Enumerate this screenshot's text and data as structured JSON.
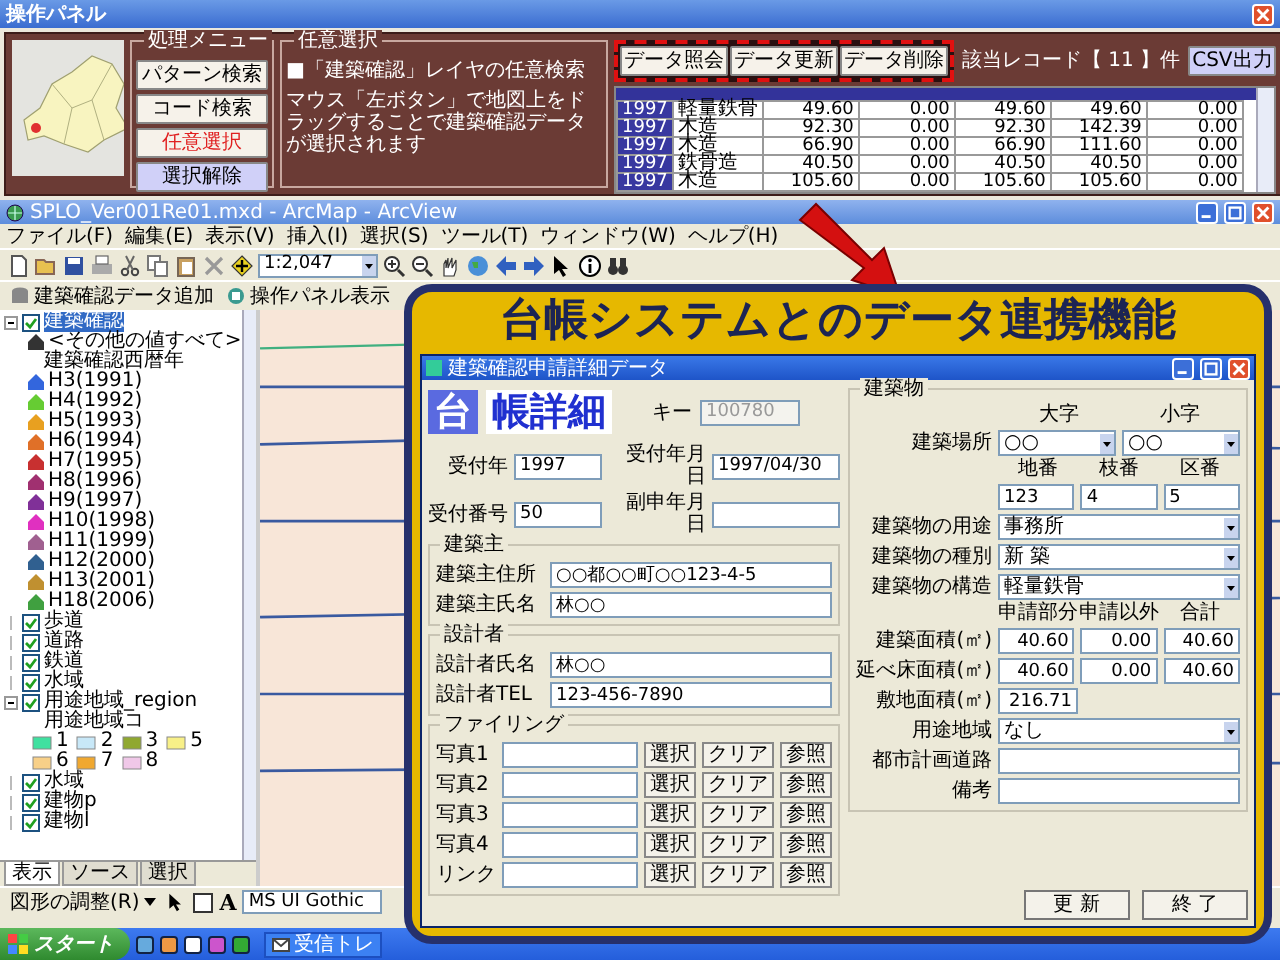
{
  "panel": {
    "title": "操作パネル",
    "menu_legend": "処理メニュー",
    "menu_buttons": [
      {
        "label": "パターン検索",
        "selected": false,
        "kind": "normal"
      },
      {
        "label": "コード検索",
        "selected": false,
        "kind": "normal"
      },
      {
        "label": "任意選択",
        "selected": true,
        "kind": "normal"
      },
      {
        "label": "選択解除",
        "selected": false,
        "kind": "reset"
      }
    ],
    "select_legend": "任意選択",
    "select_heading": "■「建築確認」レイヤの任意検索",
    "select_text": "マウス「左ボタン」で地図上をドラッグすることで建築確認データが選択されます",
    "data_buttons": [
      "データ照会",
      "データ更新",
      "データ削除"
    ],
    "record_count": "該当レコード【 11 】件",
    "csv_button": "CSV出力",
    "table": {
      "rows": [
        [
          "1997",
          "軽量鉄骨",
          "49.60",
          "0.00",
          "49.60",
          "49.60",
          "0.00"
        ],
        [
          "1997",
          "木造",
          "92.30",
          "0.00",
          "92.30",
          "142.39",
          "0.00"
        ],
        [
          "1997",
          "木造",
          "66.90",
          "0.00",
          "66.90",
          "111.60",
          "0.00"
        ],
        [
          "1997",
          "鉄骨造",
          "40.50",
          "0.00",
          "40.50",
          "40.50",
          "0.00"
        ],
        [
          "1997",
          "木造",
          "105.60",
          "0.00",
          "105.60",
          "105.60",
          "0.00"
        ]
      ]
    }
  },
  "arcmap": {
    "title": "SPLO_Ver001Re01.mxd - ArcMap - ArcView",
    "menu": [
      "ファイル(F)",
      "編集(E)",
      "表示(V)",
      "挿入(I)",
      "選択(S)",
      "ツール(T)",
      "ウィンドウ(W)",
      "ヘルプ(H)"
    ],
    "scale": "1:2,047",
    "tool_buttons": [
      "建築確認データ追加",
      "操作パネル表示"
    ],
    "toc": [
      {
        "label": "建築確認",
        "checked": true,
        "selected": true,
        "children": [
          {
            "kind": "symbol",
            "label": "<その他の値すべて>",
            "color": "#333333"
          },
          {
            "kind": "heading",
            "label": "建築確認西暦年"
          },
          {
            "kind": "symbol",
            "label": "H3(1991)",
            "color": "#3366dd"
          },
          {
            "kind": "symbol",
            "label": "H4(1992)",
            "color": "#66cc33"
          },
          {
            "kind": "symbol",
            "label": "H5(1993)",
            "color": "#e8a020"
          },
          {
            "kind": "symbol",
            "label": "H6(1994)",
            "color": "#e07028"
          },
          {
            "kind": "symbol",
            "label": "H7(1995)",
            "color": "#c83030"
          },
          {
            "kind": "symbol",
            "label": "H8(1996)",
            "color": "#a03070"
          },
          {
            "kind": "symbol",
            "label": "H9(1997)",
            "color": "#803098"
          },
          {
            "kind": "symbol",
            "label": "H10(1998)",
            "color": "#e030c0"
          },
          {
            "kind": "symbol",
            "label": "H11(1999)",
            "color": "#a06090"
          },
          {
            "kind": "symbol",
            "label": "H12(2000)",
            "color": "#306090"
          },
          {
            "kind": "symbol",
            "label": "H13(2001)",
            "color": "#c09030"
          },
          {
            "kind": "symbol",
            "label": "H18(2006)",
            "color": "#40a040"
          }
        ]
      },
      {
        "label": "歩道",
        "checked": true,
        "selected": false
      },
      {
        "label": "道路",
        "checked": true,
        "selected": false
      },
      {
        "label": "鉄道",
        "checked": true,
        "selected": false
      },
      {
        "label": "水域",
        "checked": true,
        "selected": false
      },
      {
        "label": "用途地域_region",
        "checked": true,
        "selected": false,
        "children": [
          {
            "kind": "heading",
            "label": "用途地域コ"
          },
          {
            "kind": "swatch",
            "label": "1",
            "color": "#40e0a0"
          },
          {
            "kind": "swatch",
            "label": "2",
            "color": "#c8e8f8"
          },
          {
            "kind": "swatch",
            "label": "3",
            "color": "#90a830"
          },
          {
            "kind": "swatch",
            "label": "5",
            "color": "#f8f088"
          },
          {
            "kind": "swatch",
            "label": "6",
            "color": "#f8d088"
          },
          {
            "kind": "swatch",
            "label": "7",
            "color": "#f0a830"
          },
          {
            "kind": "swatch",
            "label": "8",
            "color": "#f0c8e8"
          }
        ]
      },
      {
        "label": "水域",
        "checked": true,
        "selected": false
      },
      {
        "label": "建物p",
        "checked": true,
        "selected": false
      },
      {
        "label": "建物l",
        "checked": true,
        "selected": false
      }
    ],
    "toc_tabs": [
      {
        "label": "表示",
        "selected": true
      },
      {
        "label": "ソース",
        "selected": false
      },
      {
        "label": "選択",
        "selected": false
      }
    ],
    "draw_menu": "図形の調整(R)",
    "text_tool": "A",
    "font": "MS UI Gothic"
  },
  "taskbar": {
    "start": "スタート",
    "task": "受信トレ"
  },
  "callout": {
    "title": "台帳システムとのデータ連携機能",
    "form": {
      "title": "建築確認申請詳細データ",
      "logo_mark": "台",
      "logo_text": "帳詳細",
      "key_label": "キー",
      "key_value": "100780",
      "key_disabled": true,
      "fields": [
        {
          "label": "受付年",
          "value": "1997"
        },
        {
          "label": "受付年月日",
          "value": "1997/04/30"
        },
        {
          "label": "受付番号",
          "value": "50"
        },
        {
          "label": "副申年月日"
        }
      ],
      "groups": [
        {
          "legend": "建築主",
          "fields": [
            {
              "label": "建築主住所",
              "value": "○○都○○町○○123-4-5"
            },
            {
              "label": "建築主氏名",
              "value": "林○○"
            }
          ]
        },
        {
          "legend": "設計者",
          "fields": [
            {
              "label": "設計者氏名",
              "value": "林○○"
            },
            {
              "label": "設計者TEL",
              "value": "123-456-7890"
            }
          ]
        }
      ],
      "filing": {
        "legend": "ファイリング",
        "rows": [
          {
            "label": "写真1",
            "buttons": [
              "選択",
              "クリア",
              "参照"
            ]
          },
          {
            "label": "写真2",
            "buttons": [
              "選択",
              "クリア",
              "参照"
            ]
          },
          {
            "label": "写真3",
            "buttons": [
              "選択",
              "クリア",
              "参照"
            ]
          },
          {
            "label": "写真4",
            "buttons": [
              "選択",
              "クリア",
              "参照"
            ]
          },
          {
            "label": "リンク",
            "buttons": [
              "選択",
              "クリア",
              "参照"
            ]
          }
        ]
      },
      "building": {
        "legend": "建築物",
        "place_heads": [
          "大字",
          "小字"
        ],
        "place_label": "建築場所",
        "place": [
          "○○",
          "○○"
        ],
        "lot_heads": [
          "地番",
          "枝番",
          "区番"
        ],
        "lot": [
          "123",
          "4",
          "5"
        ],
        "selects": [
          {
            "label": "建築物の用途",
            "value": "事務所"
          },
          {
            "label": "建築物の種別",
            "value": "新 築"
          },
          {
            "label": "建築物の構造",
            "value": "軽量鉄骨"
          }
        ],
        "area_heads": [
          "申請部分",
          "申請以外",
          "合計"
        ],
        "areas": [
          {
            "label": "建築面積(㎡)",
            "values": [
              "40.60",
              "0.00",
              "40.60"
            ]
          },
          {
            "label": "延べ床面積(㎡)",
            "values": [
              "40.60",
              "0.00",
              "40.60"
            ]
          }
        ],
        "site_label": "敷地面積(㎡)",
        "site_value": "216.71",
        "zone_label": "用途地域",
        "zone_value": "なし",
        "plan_label": "都市計画道路",
        "note_label": "備考"
      },
      "buttons": [
        "更 新",
        "終 了"
      ]
    }
  }
}
